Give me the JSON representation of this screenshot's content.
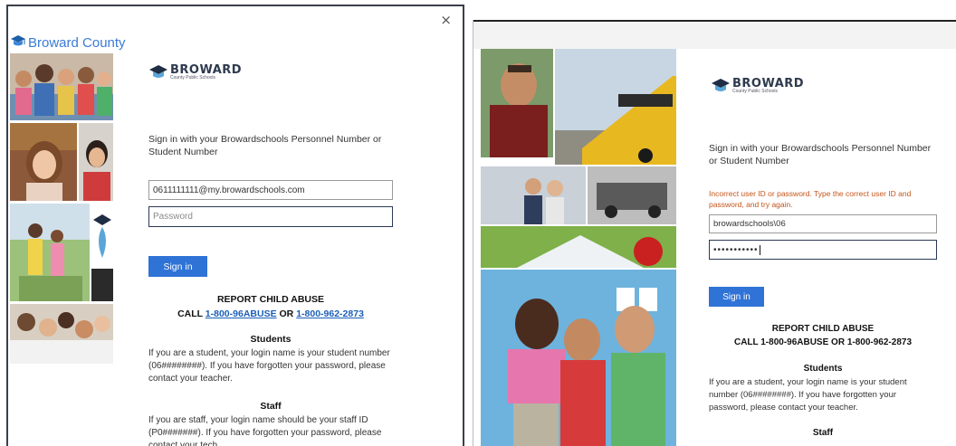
{
  "left": {
    "close_glyph": "×",
    "brand_text": "Broward County",
    "logo_title": "BROWARD",
    "logo_sub": "County Public Schools",
    "sign_in_prompt": "Sign in with your Browardschools Personnel Number or Student Number",
    "username_value": "0611111111@my.browardschools.com",
    "password_placeholder": "Password",
    "sign_in_button": "Sign in",
    "abuse_heading": "REPORT CHILD ABUSE",
    "abuse_call_prefix": "CALL ",
    "abuse_phone_1": "1-800-96ABUSE",
    "abuse_or": " OR ",
    "abuse_phone_2": "1-800-962-2873",
    "students_heading": "Students",
    "students_text": "If you are a student, your login name is your student number (06########). If you have forgotten your password, please contact your teacher.",
    "staff_heading": "Staff",
    "staff_text": "If you are staff, your login name should be your staff ID (P0#######). If you have forgotten your password, please contact your tech."
  },
  "right": {
    "logo_title": "BROWARD",
    "logo_sub": "County Public Schools",
    "sign_in_prompt": "Sign in with your Browardschools Personnel Number or Student Number",
    "error_text": "Incorrect user ID or password. Type the correct user ID and password, and try again.",
    "username_value": "browardschools\\06",
    "password_value": "•••••••••••",
    "sign_in_button": "Sign in",
    "abuse_heading": "REPORT CHILD ABUSE",
    "abuse_call": "CALL 1-800-96ABUSE OR 1-800-962-2873",
    "students_heading": "Students",
    "students_text": "If you are a student, your login name is your student number (06########). If you have forgotten your password, please contact your teacher.",
    "staff_heading": "Staff"
  },
  "colors": {
    "accent_blue": "#2f73d6",
    "link_blue": "#1b5fb8",
    "error_orange": "#c4551a"
  },
  "icons": [
    "graduation-cap-icon",
    "close-icon"
  ]
}
